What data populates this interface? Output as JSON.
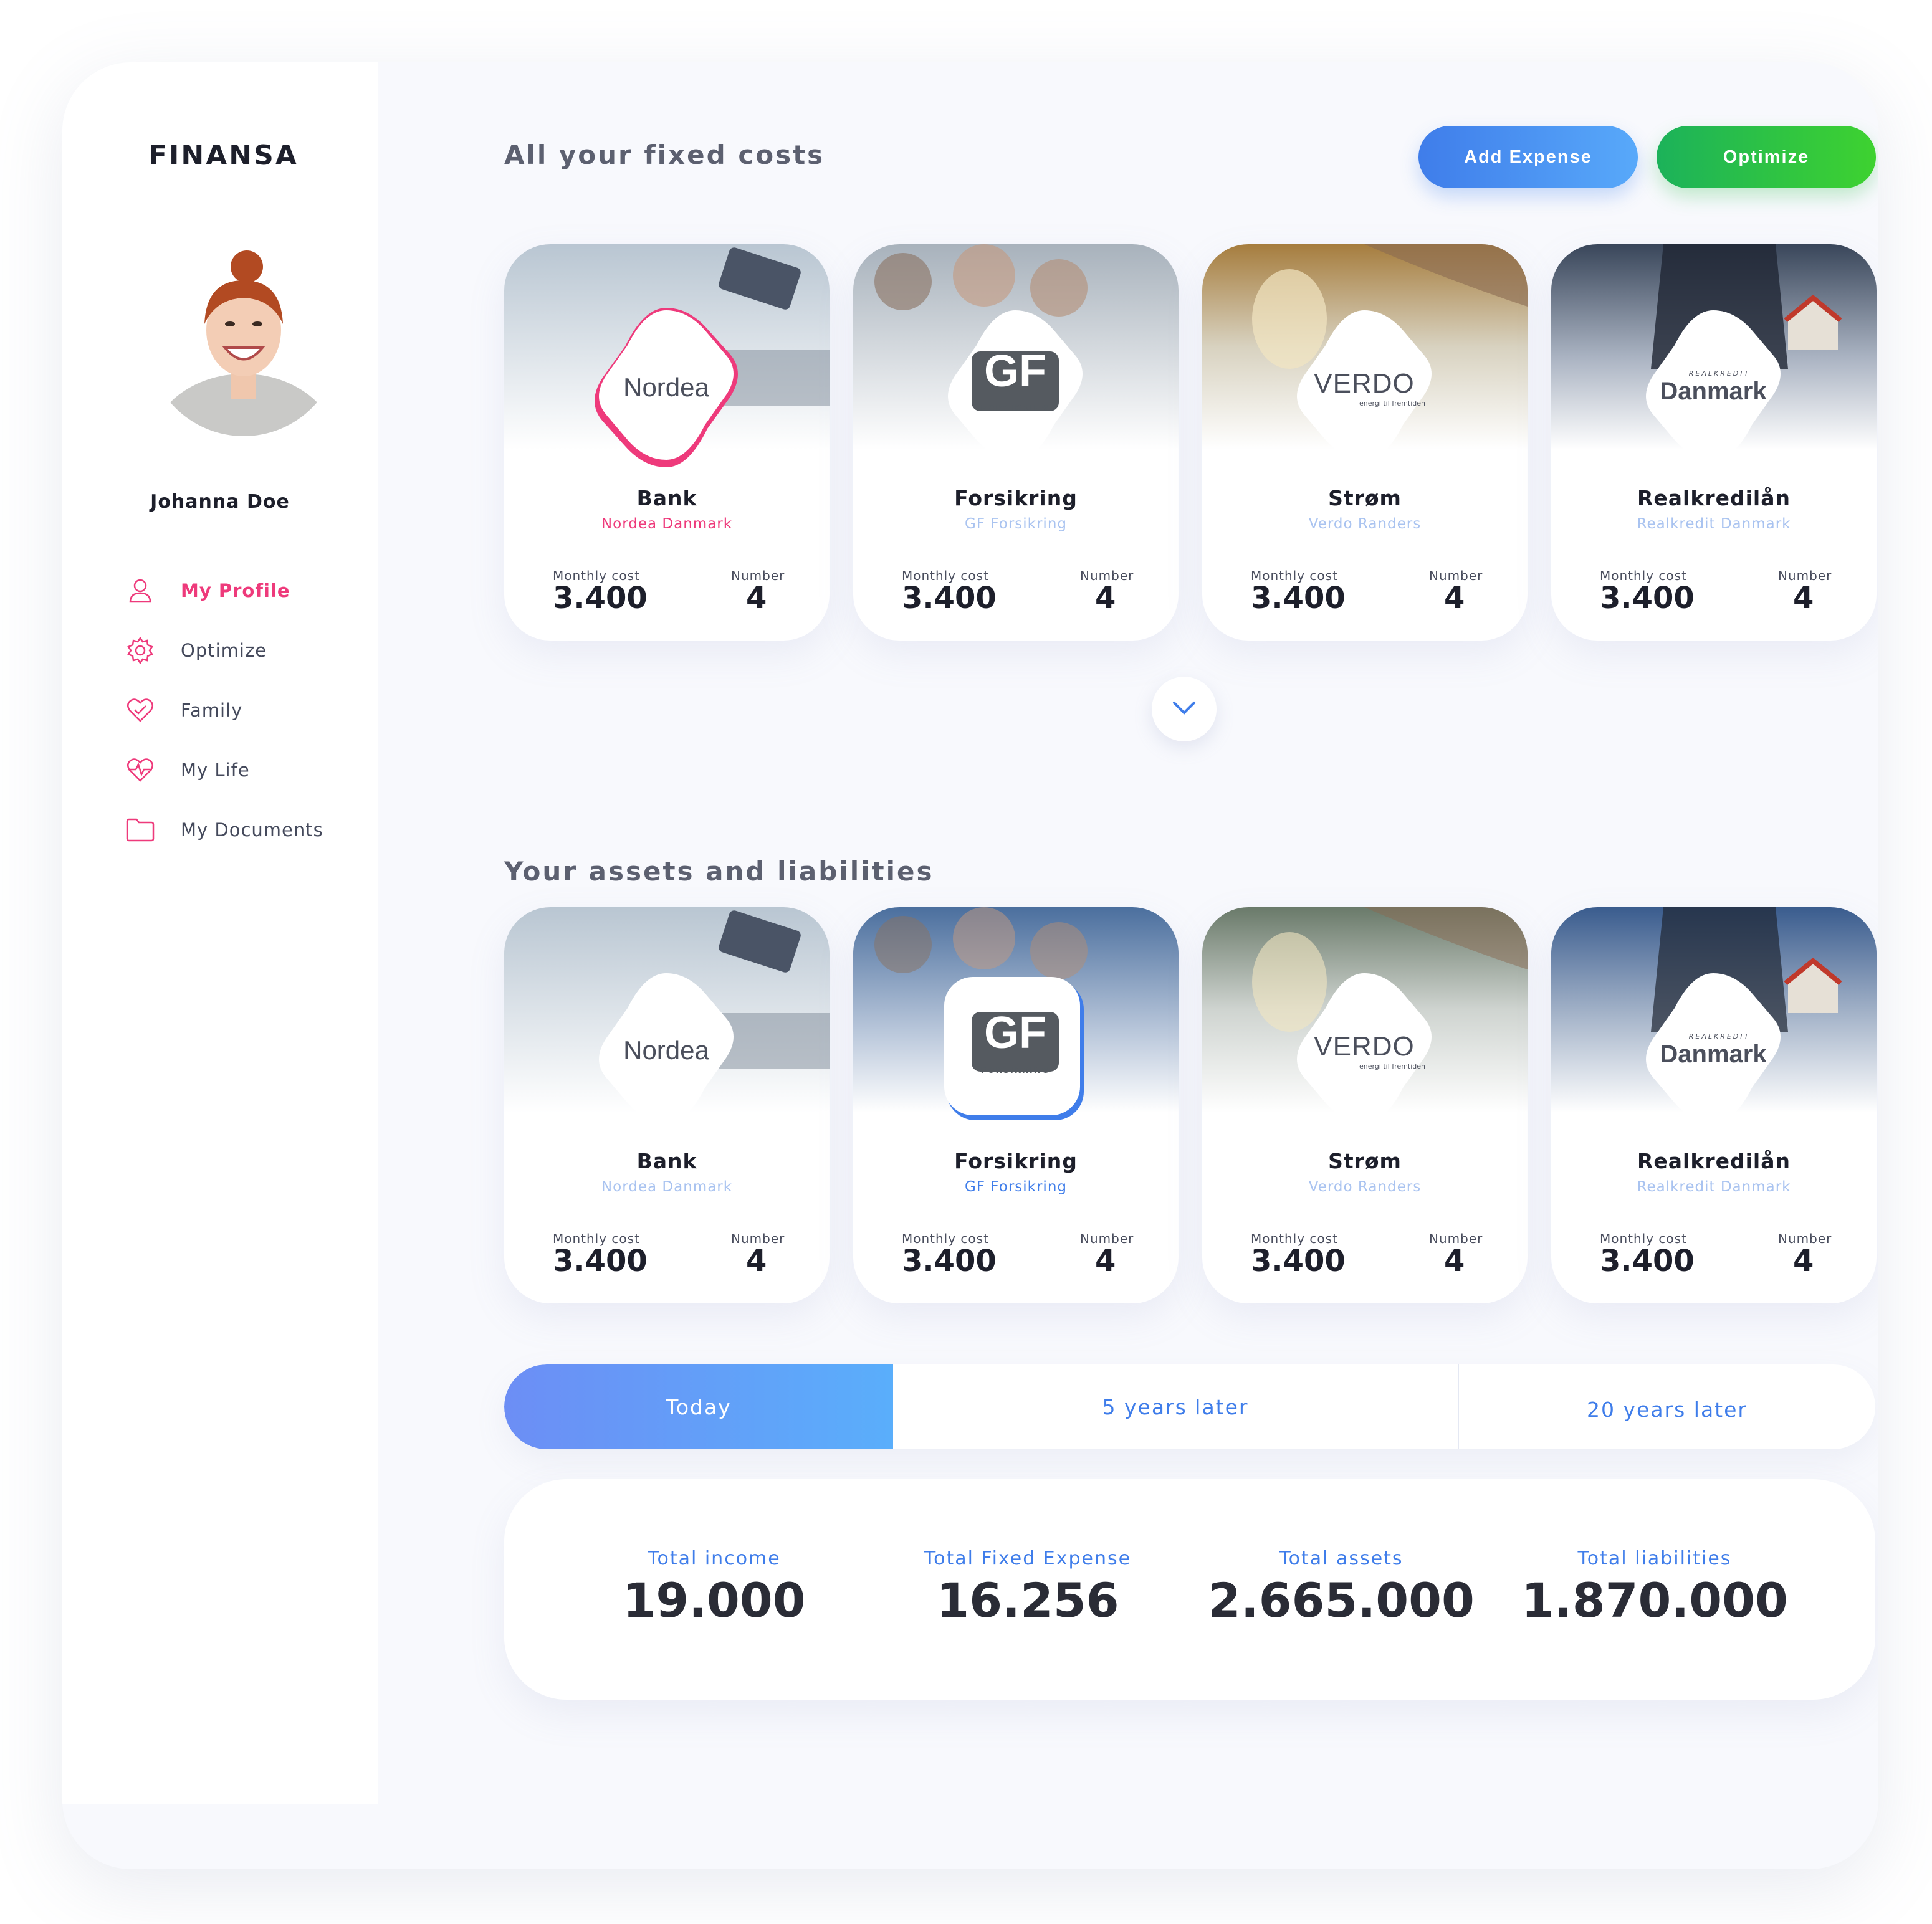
{
  "app": {
    "logo": "FINANSA"
  },
  "user": {
    "name": "Johanna Doe"
  },
  "sidebar": {
    "items": [
      {
        "label": "My Profile",
        "icon": "user-icon",
        "active": true
      },
      {
        "label": "Optimize",
        "icon": "gear-icon",
        "active": false
      },
      {
        "label": "Family",
        "icon": "heart-icon",
        "active": false
      },
      {
        "label": "My Life",
        "icon": "heartbeat-icon",
        "active": false
      },
      {
        "label": "My Documents",
        "icon": "folder-icon",
        "active": false
      }
    ]
  },
  "header": {
    "fixed_costs_title": "All your fixed costs",
    "assets_title": "Your assets and liabilities",
    "add_expense": "Add Expense",
    "optimize": "Optimize"
  },
  "fixed_costs": [
    {
      "title": "Bank",
      "provider": "Nordea Danmark",
      "logo": "Nordea",
      "monthly_label": "Monthly cost",
      "monthly": "3.400",
      "number_label": "Number",
      "number": "4"
    },
    {
      "title": "Forsikring",
      "provider": "GF Forsikring",
      "logo": "GF",
      "logo_sub": "FORSIKRING",
      "monthly_label": "Monthly cost",
      "monthly": "3.400",
      "number_label": "Number",
      "number": "4"
    },
    {
      "title": "Strøm",
      "provider": "Verdo Randers",
      "logo": "VERDO",
      "logo_sub": "energi til fremtiden",
      "monthly_label": "Monthly cost",
      "monthly": "3.400",
      "number_label": "Number",
      "number": "4"
    },
    {
      "title": "Realkredilån",
      "provider": "Realkredit Danmark",
      "logo": "Danmark",
      "logo_sub": "REALKREDIT",
      "monthly_label": "Monthly cost",
      "monthly": "3.400",
      "number_label": "Number",
      "number": "4"
    }
  ],
  "assets": [
    {
      "title": "Bank",
      "provider": "Nordea Danmark",
      "logo": "Nordea",
      "monthly_label": "Monthly cost",
      "monthly": "3.400",
      "number_label": "Number",
      "number": "4"
    },
    {
      "title": "Forsikring",
      "provider": "GF Forsikring",
      "logo": "GF",
      "logo_sub": "FORSIKRING",
      "monthly_label": "Monthly cost",
      "monthly": "3.400",
      "number_label": "Number",
      "number": "4"
    },
    {
      "title": "Strøm",
      "provider": "Verdo Randers",
      "logo": "VERDO",
      "logo_sub": "energi til fremtiden",
      "monthly_label": "Monthly cost",
      "monthly": "3.400",
      "number_label": "Number",
      "number": "4"
    },
    {
      "title": "Realkredilån",
      "provider": "Realkredit Danmark",
      "logo": "Danmark",
      "logo_sub": "REALKREDIT",
      "monthly_label": "Monthly cost",
      "monthly": "3.400",
      "number_label": "Number",
      "number": "4"
    }
  ],
  "tabs": [
    "Today",
    "5 years later",
    "20 years later"
  ],
  "totals": [
    {
      "label": "Total income",
      "value": "19.000"
    },
    {
      "label": "Total Fixed Expense",
      "value": "16.256"
    },
    {
      "label": "Total assets",
      "value": "2.665.000"
    },
    {
      "label": "Total liabilities",
      "value": "1.870.000"
    }
  ],
  "colors": {
    "accent_pink": "#ee3a7b",
    "accent_blue": "#3f7dea",
    "accent_green": "#2fc24a"
  }
}
